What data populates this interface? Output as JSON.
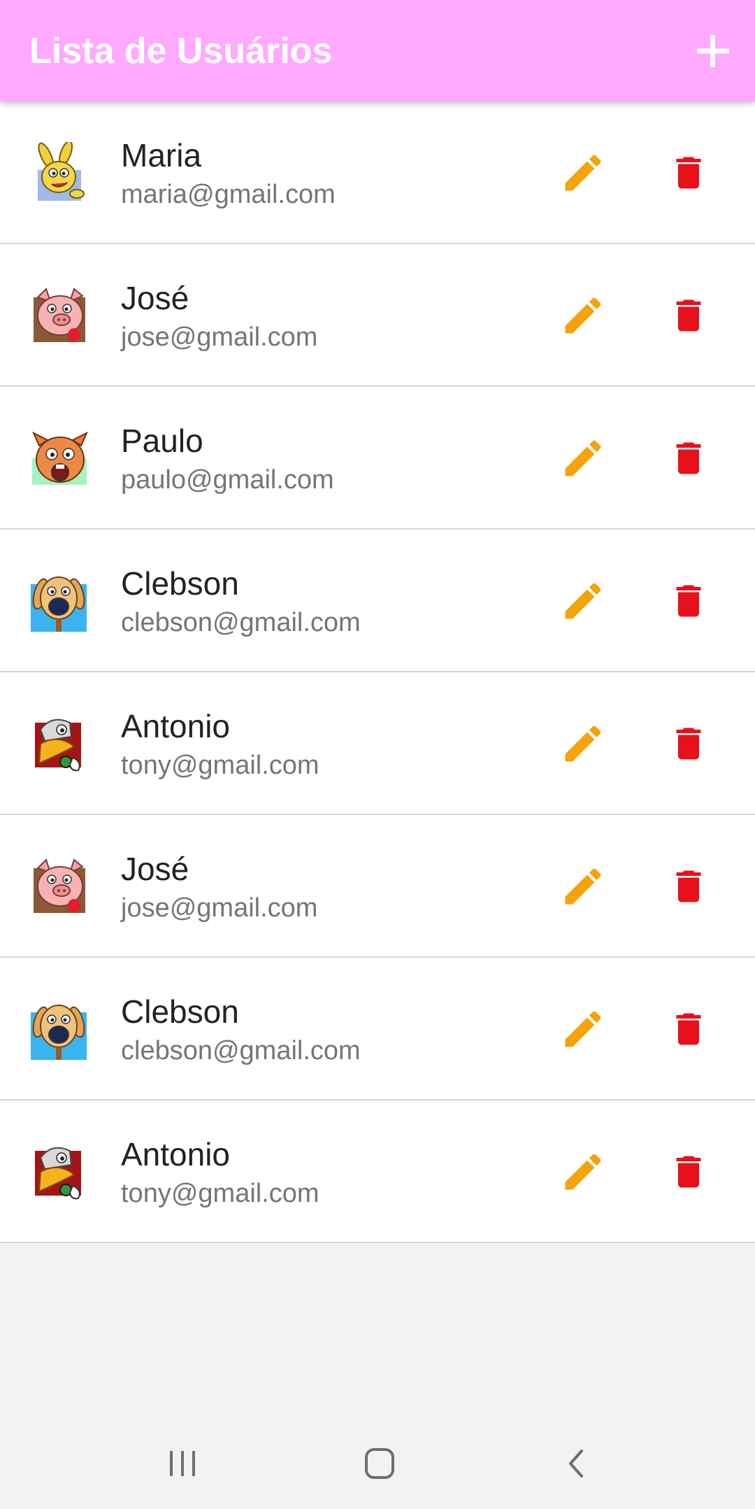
{
  "header": {
    "title": "Lista de Usuários",
    "add_icon": "plus-icon",
    "background_color": "#ffa9ff"
  },
  "users": [
    {
      "name": "Maria",
      "email": "maria@gmail.com",
      "avatar": "rabbit-avatar"
    },
    {
      "name": "José",
      "email": "jose@gmail.com",
      "avatar": "pig-avatar"
    },
    {
      "name": "Paulo",
      "email": "paulo@gmail.com",
      "avatar": "hamster-avatar"
    },
    {
      "name": "Clebson",
      "email": "clebson@gmail.com",
      "avatar": "dog-avatar"
    },
    {
      "name": "Antonio",
      "email": "tony@gmail.com",
      "avatar": "eagle-avatar"
    },
    {
      "name": "José",
      "email": "jose@gmail.com",
      "avatar": "pig-avatar"
    },
    {
      "name": "Clebson",
      "email": "clebson@gmail.com",
      "avatar": "dog-avatar"
    },
    {
      "name": "Antonio",
      "email": "tony@gmail.com",
      "avatar": "eagle-avatar"
    }
  ],
  "row_actions": {
    "edit_icon": "pencil-icon",
    "edit_color": "#f5a30a",
    "delete_icon": "trash-icon",
    "delete_color": "#e8101a"
  },
  "nav_bar": {
    "recents_icon": "recents-icon",
    "home_icon": "home-icon",
    "back_icon": "back-icon"
  }
}
